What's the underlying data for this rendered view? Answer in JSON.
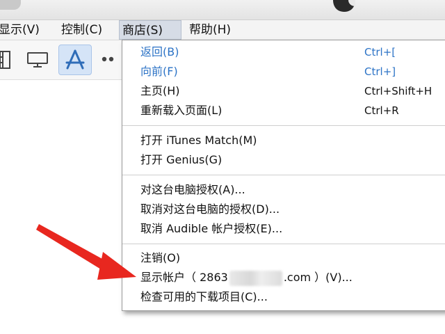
{
  "menubar": {
    "items": [
      {
        "label": "显示(V)"
      },
      {
        "label": "控制(C)"
      },
      {
        "label": "商店(S)"
      },
      {
        "label": "帮助(H)"
      }
    ]
  },
  "toolbar": {
    "icons": [
      "film-icon",
      "monitor-icon",
      "app-store-icon",
      "more-dots-icon"
    ],
    "selected": "app-store-icon"
  },
  "store_menu": {
    "groups": [
      [
        {
          "label": "返回(B)",
          "shortcut": "Ctrl+[",
          "enabled": false
        },
        {
          "label": "向前(F)",
          "shortcut": "Ctrl+]",
          "enabled": false
        },
        {
          "label": "主页(H)",
          "shortcut": "Ctrl+Shift+H",
          "enabled": true
        },
        {
          "label": "重新载入页面(L)",
          "shortcut": "Ctrl+R",
          "enabled": true
        }
      ],
      [
        {
          "label": "打开 iTunes Match(M)",
          "enabled": true
        },
        {
          "label": "打开 Genius(G)",
          "enabled": true
        }
      ],
      [
        {
          "label": "对这台电脑授权(A)...",
          "enabled": true
        },
        {
          "label": "取消对这台电脑的授权(D)...",
          "enabled": true
        },
        {
          "label": "取消 Audible 帐户授权(E)...",
          "enabled": true
        }
      ],
      [
        {
          "label": "注销(O)",
          "enabled": true
        },
        {
          "label_prefix": "显示帐户（ 2863",
          "label_suffix": ".com ）(V)...",
          "enabled": true,
          "redacted": true
        },
        {
          "label": "检查可用的下载项目(C)...",
          "enabled": true
        }
      ]
    ]
  },
  "colors": {
    "disabled_text": "#2c73c6",
    "arrow": "#e8271f",
    "active_menu_bg": "#d6dce6"
  }
}
